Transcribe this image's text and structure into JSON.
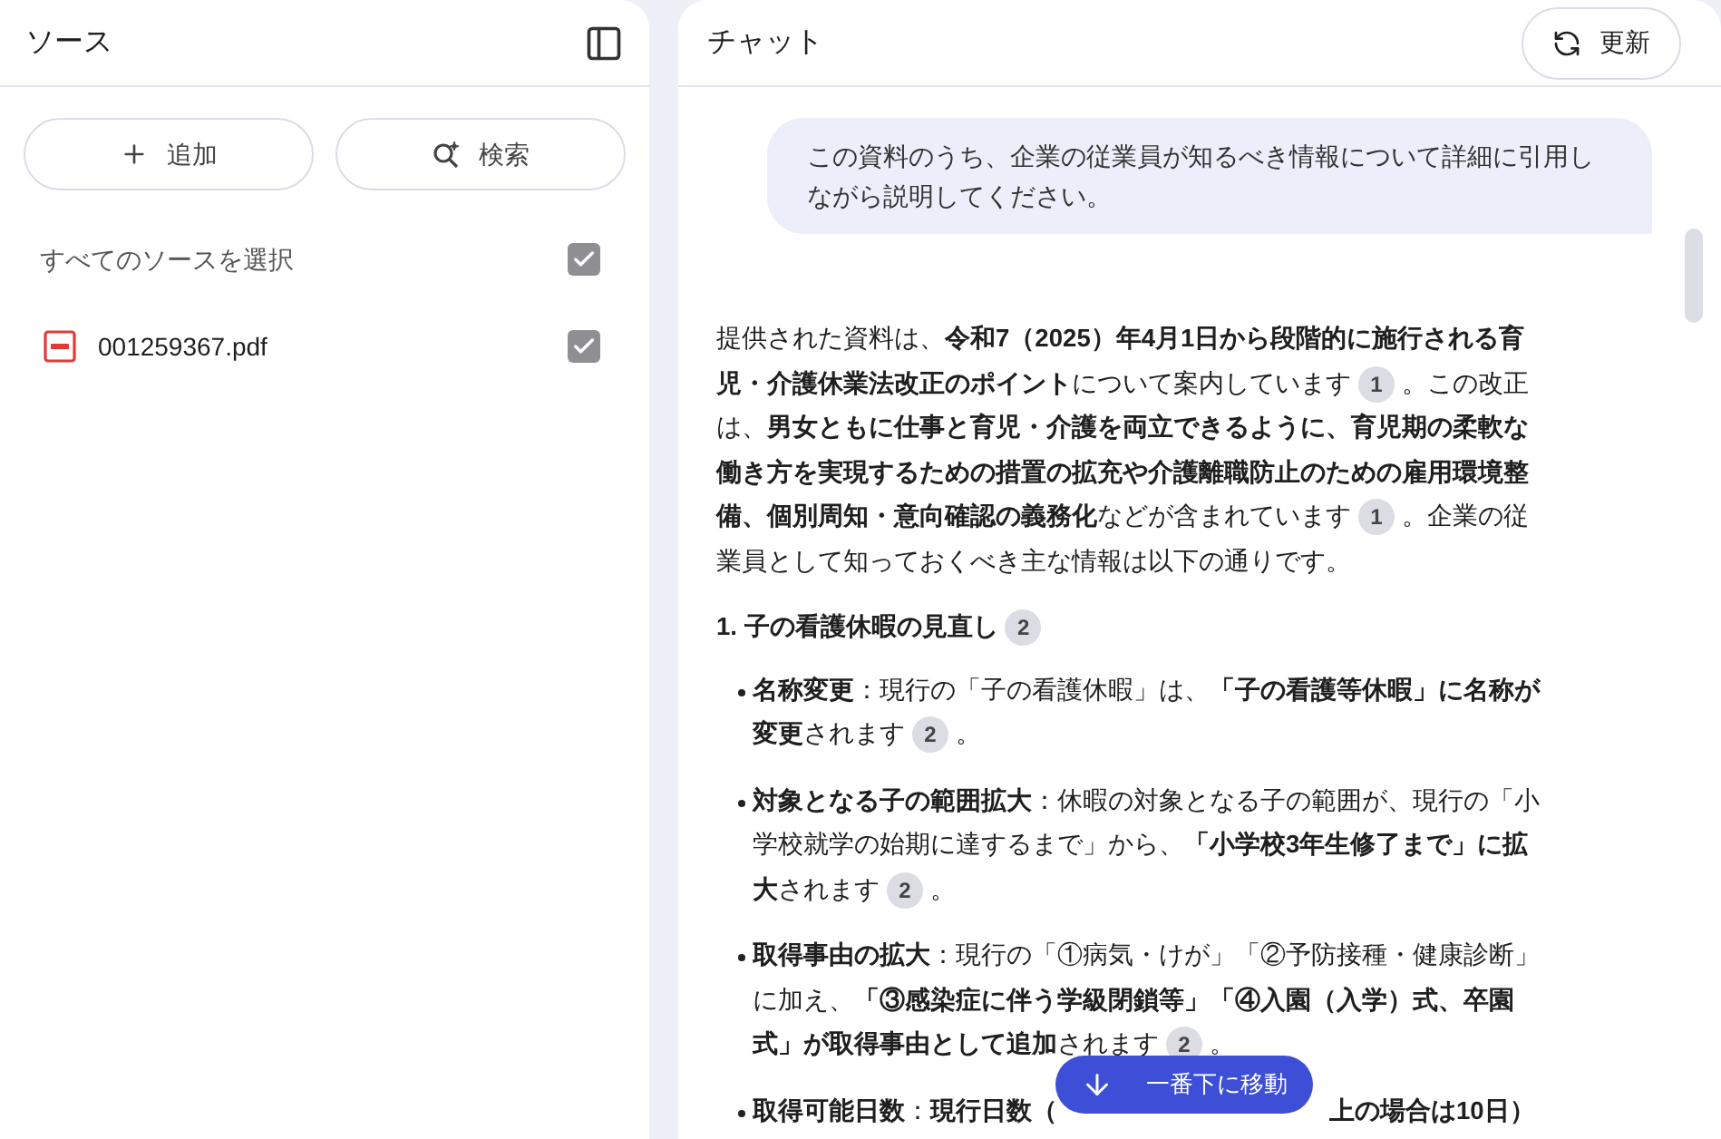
{
  "sources": {
    "title": "ソース",
    "buttons": [
      {
        "kind": "add",
        "label": "追加"
      },
      {
        "kind": "discover",
        "label": "検索"
      }
    ],
    "select_all": {
      "label": "すべてのソースを選択",
      "checked": true
    },
    "items": [
      {
        "name": "001259367.pdf",
        "checked": true
      }
    ]
  },
  "chat": {
    "title": "チャット",
    "refresh_label": "更新",
    "user_message": "この資料のうち、企業の従業員が知るべき情報について詳細に引用しながら説明してください。",
    "response": [
      {
        "kind": "paragraph",
        "parts": [
          {
            "kind": "text",
            "text": "提供された資料は、**令和7（2025）年4月1日から段階的に施行される育児・介護休業法改正のポイント**について案内しています"
          },
          {
            "kind": "cite",
            "label": "1"
          },
          {
            "kind": "text",
            "text": "。この改正は、**男女ともに仕事と育児・介護を両立できるように、育児期の柔軟な働き方を実現するための措置の拡充や介護離職防止のための雇用環境整備、個別周知・意向確認の義務化**などが含まれています"
          },
          {
            "kind": "cite",
            "label": "1"
          },
          {
            "kind": "text",
            "text": "。企業の従業員として知っておくべき主な情報は以下の通りです。"
          }
        ]
      },
      {
        "kind": "heading",
        "parts": [
          {
            "kind": "text",
            "text": "1. 子の看護休暇の見直し"
          },
          {
            "kind": "cite",
            "label": "2"
          }
        ]
      },
      {
        "kind": "bullet",
        "parts": [
          {
            "kind": "text",
            "text": "**名称変更**：現行の「子の看護休暇」は、**「子の看護等休暇」に名称が変更**されます"
          },
          {
            "kind": "cite",
            "label": "2"
          },
          {
            "kind": "text",
            "text": "。"
          }
        ]
      },
      {
        "kind": "bullet",
        "parts": [
          {
            "kind": "text",
            "text": "**対象となる子の範囲拡大**：休暇の対象となる子の範囲が、現行の「小学校就学の始期に達するまで」から、**「小学校3年生修了まで」に拡大**されます"
          },
          {
            "kind": "cite",
            "label": "2"
          },
          {
            "kind": "text",
            "text": "。"
          }
        ]
      },
      {
        "kind": "bullet",
        "parts": [
          {
            "kind": "text",
            "text": "**取得事由の拡大**：現行の「①病気・けが」「②予防接種・健康診断」に加え、**「③感染症に伴う学級閉鎖等」「④入園（入学）式、卒園式」が取得事由として追加**されます"
          },
          {
            "kind": "cite",
            "label": "2"
          },
          {
            "kind": "text",
            "text": "。"
          }
        ]
      },
      {
        "kind": "bullet",
        "parts": [
          {
            "kind": "text",
            "text": "**取得可能日数**：**現行日数（**"
          },
          {
            "kind": "text",
            "text": "**上の場合は10日）**"
          }
        ]
      }
    ],
    "scroll_button": "一番下に移動"
  }
}
